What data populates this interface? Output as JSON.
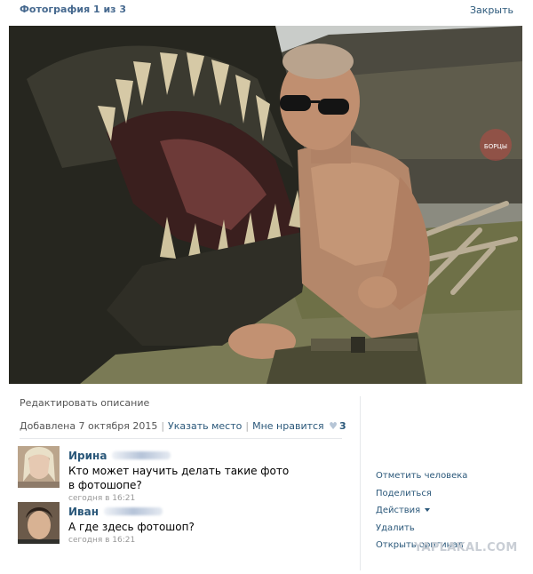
{
  "header": {
    "photo_counter": "Фотография 1 из 3",
    "close_label": "Закрыть"
  },
  "photo": {
    "stamp_text": "БОРЦЫ"
  },
  "info": {
    "edit_description": "Редактировать описание",
    "added_date": "Добавлена 7 октября 2015",
    "specify_place": "Указать место",
    "like_label": "Мне нравится",
    "like_count": "3"
  },
  "comments": [
    {
      "author": "Ирина",
      "text": "Кто может научить делать такие фото в фотошопе?",
      "time": "сегодня в 16:21"
    },
    {
      "author": "Иван",
      "text": "А где здесь фотошоп?",
      "time": "сегодня в 16:21"
    }
  ],
  "actions": {
    "tag_person": "Отметить человека",
    "share": "Поделиться",
    "more_actions": "Действия",
    "delete": "Удалить",
    "open_original": "Открыть оригинал"
  },
  "watermark": "YAPLAKAL.COM",
  "colors": {
    "link": "#2b587a",
    "header": "#45688e",
    "muted": "#999999"
  }
}
